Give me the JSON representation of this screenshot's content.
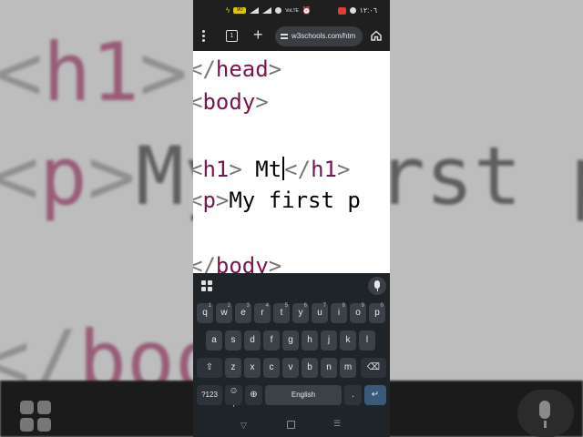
{
  "background": {
    "code_lines": [
      {
        "tag_open": "<",
        "keyword": "h1",
        "tag_close": ">"
      },
      {
        "tag_open": "<",
        "keyword": "p",
        "tag_close": ">",
        "text": "My first p"
      },
      {
        "tag_open": "</",
        "keyword": "boo",
        "tag_close": ""
      }
    ]
  },
  "status_bar": {
    "battery_label": "90",
    "network_label": "VoLTE",
    "time": "١٢:٠٦"
  },
  "browser": {
    "url": "w3schools.com/htm",
    "tab_count": "1",
    "new_tab_symbol": "+"
  },
  "code_editor": {
    "line1": {
      "tag_open": "</",
      "keyword": "head",
      "tag_close": ">"
    },
    "line2": {
      "tag_open": "<",
      "keyword": "body",
      "tag_close": ">"
    },
    "line3": {
      "open_a": "<",
      "open_kw": "h1",
      "open_b": ">",
      "text": " Mt",
      "close_a": "</",
      "close_kw": "h1",
      "close_b": ">"
    },
    "line4": {
      "tag_open": "<",
      "keyword": "p",
      "tag_close": ">",
      "text": "My first p"
    },
    "line5": {
      "tag_open": "</",
      "keyword": "body",
      "tag_close": ">"
    }
  },
  "keyboard": {
    "row1": [
      {
        "label": "q",
        "hint": "1"
      },
      {
        "label": "w",
        "hint": "2"
      },
      {
        "label": "e",
        "hint": "3"
      },
      {
        "label": "r",
        "hint": "4"
      },
      {
        "label": "t",
        "hint": "5"
      },
      {
        "label": "y",
        "hint": "6"
      },
      {
        "label": "u",
        "hint": "7"
      },
      {
        "label": "i",
        "hint": "8"
      },
      {
        "label": "o",
        "hint": "9"
      },
      {
        "label": "p",
        "hint": "0"
      }
    ],
    "row2": [
      "a",
      "s",
      "d",
      "f",
      "g",
      "h",
      "j",
      "k",
      "l"
    ],
    "row3": [
      "z",
      "x",
      "c",
      "v",
      "b",
      "n",
      "m"
    ],
    "shift_symbol": "⇧",
    "backspace_symbol": "⌫",
    "symbols_label": "?123",
    "emoji_symbol": "☺",
    "emoji_sub": ",",
    "globe_symbol": "⊕",
    "space_label": "English",
    "period_label": ".",
    "enter_symbol": "↵"
  },
  "nav_bar": {
    "back_symbol": "▽",
    "recent_symbol": "☰"
  }
}
